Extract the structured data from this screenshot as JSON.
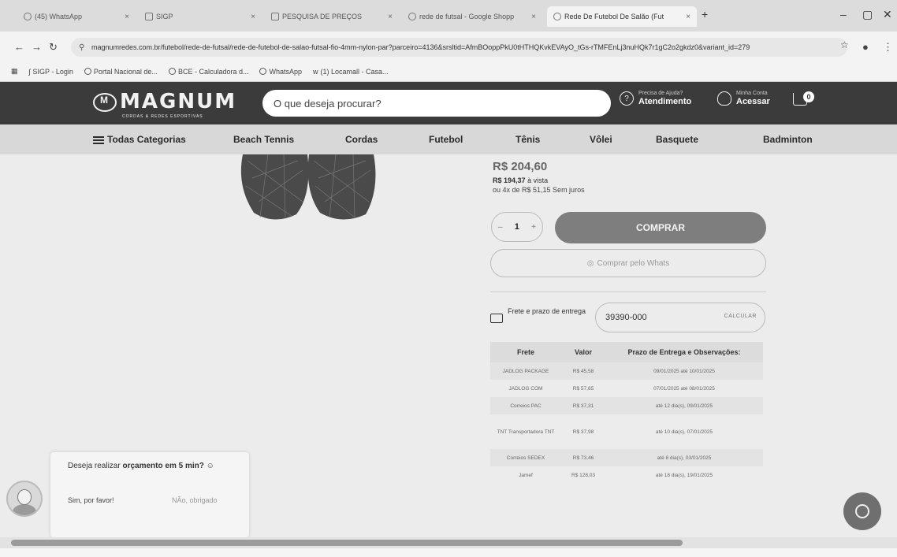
{
  "browser": {
    "tabs": [
      {
        "label": "(45) WhatsApp",
        "close": "×"
      },
      {
        "label": "SIGP",
        "close": "×"
      },
      {
        "label": "PESQUISA DE PREÇOS",
        "close": "×"
      },
      {
        "label": "rede de futsal - Google Shopp",
        "close": "×"
      },
      {
        "label": "Rede De Futebol De Salão (Fut",
        "close": "×"
      }
    ],
    "new_tab": "+",
    "window_controls": {
      "minimize": "–",
      "maximize": "▢",
      "close": "✕"
    },
    "nav": {
      "back": "←",
      "forward": "→",
      "reload": "↻"
    },
    "url": "magnumredes.com.br/futebol/rede-de-futsal/rede-de-futebol-de-salao-futsal-fio-4mm-nylon-par?parceiro=4136&srsltid=AfmBOoppPkU0tHTHQKvkEVAyO_tGs-rTMFEnLj3nuHQk7r1gC2o2gkdz0&variant_id=279",
    "bookmarks": [
      "SIGP - Login",
      "Portal Nacional de...",
      "BCE - Calculadora d...",
      "WhatsApp",
      "(1) Locamall - Casa..."
    ]
  },
  "header": {
    "logo": "MAGNUM",
    "logo_sub": "CORDAS & REDES ESPORTIVAS",
    "search_placeholder": "O que deseja procurar?",
    "help_small": "Precisa de Ajuda?",
    "help_big": "Atendimento",
    "account_small": "Minha Conta",
    "account_big": "Acessar",
    "cart_count": "0"
  },
  "categories": [
    "Todas Categorias",
    "Beach Tennis",
    "Cordas",
    "Futebol",
    "Tênis",
    "Vôlei",
    "Basquete",
    "Badminton"
  ],
  "product": {
    "price": "R$ 204,60",
    "cash_price": "R$ 194,37",
    "cash_suffix": "à vista",
    "installments": "ou 4x de R$ 51,15 Sem juros",
    "qty_minus": "–",
    "qty": "1",
    "qty_plus": "+",
    "buy_label": "COMPRAR",
    "whats_label": "Comprar pelo Whats"
  },
  "shipping": {
    "label": "Frete e prazo de entrega",
    "cep": "39390-000",
    "calc_label": "CALCULAR",
    "columns": [
      "Frete",
      "Valor",
      "Prazo de Entrega e Observações:"
    ],
    "rows": [
      [
        "JADLOG PACKAGE",
        "R$ 45,58",
        "09/01/2025 até 10/01/2025"
      ],
      [
        "JADLOG COM",
        "R$ 57,65",
        "07/01/2025 até 08/01/2025"
      ],
      [
        "Correios PAC",
        "R$ 37,31",
        "até 12 dia(s), 09/01/2025"
      ],
      [
        "TNT Transportadora TNT",
        "R$ 37,98",
        "até 10 dia(s), 07/01/2025"
      ],
      [
        "Correios SEDEX",
        "R$ 73,46",
        "até 8 dia(s), 03/01/2025"
      ],
      [
        "Jamef",
        "R$ 128,03",
        "até 18 dia(s), 19/01/2025"
      ]
    ]
  },
  "chat": {
    "question_prefix": "Deseja realizar ",
    "question_bold": "orçamento em 5 min?",
    "yes": "Sim, por favor!",
    "no": "NÃo, obrigado"
  }
}
